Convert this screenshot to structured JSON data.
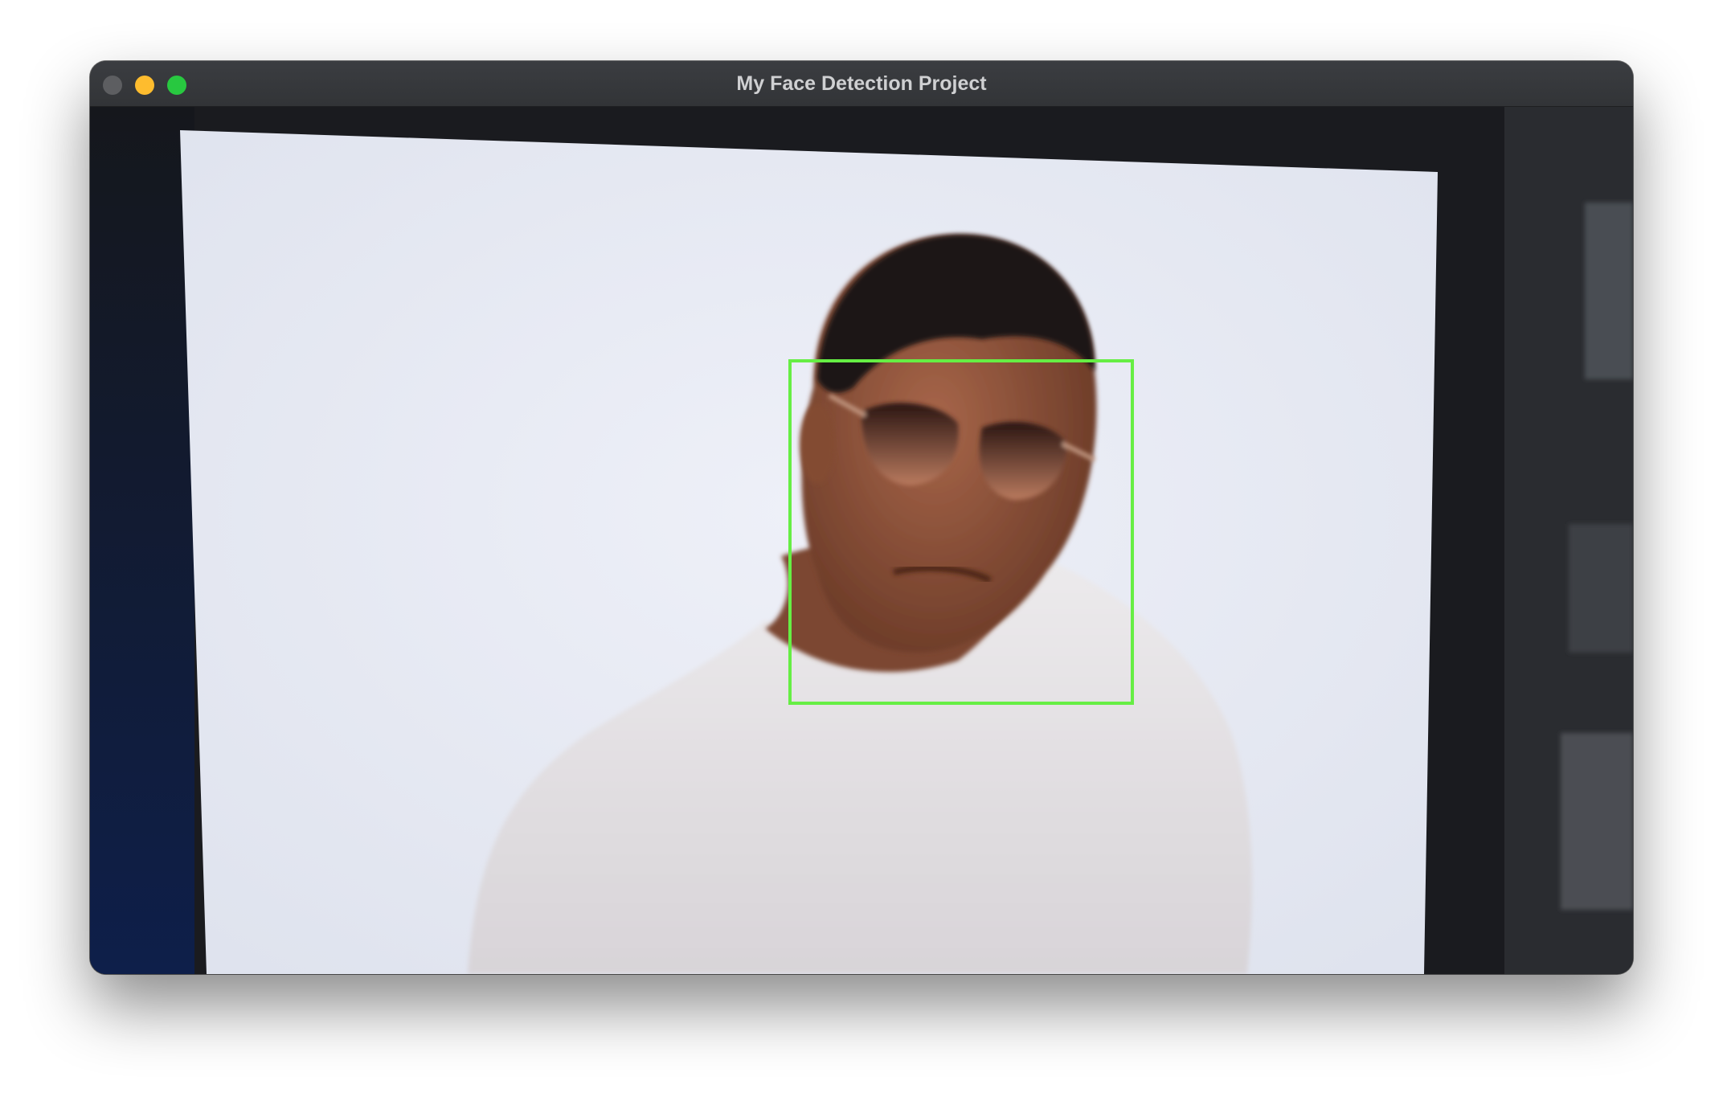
{
  "window": {
    "title": "My Face Detection Project"
  },
  "traffic_lights": {
    "close_color": "#5d5e61",
    "minimize_color": "#febc2e",
    "zoom_color": "#28c840"
  },
  "detection": {
    "box_color": "#66ee44",
    "faces_detected": 1
  },
  "icons": [
    "close-icon",
    "minimize-icon",
    "zoom-icon"
  ]
}
